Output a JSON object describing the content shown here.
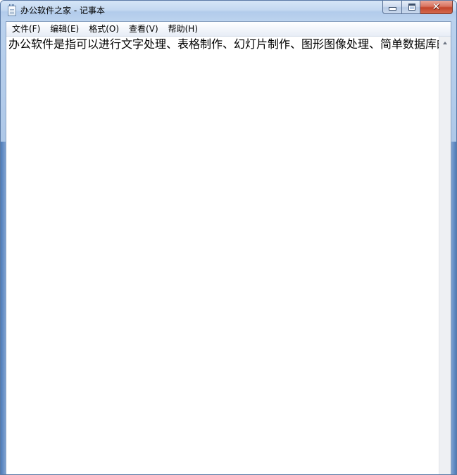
{
  "window": {
    "title": "办公软件之家 - 记事本",
    "app_icon": "notepad-icon"
  },
  "caption_buttons": {
    "minimize_icon": "minimize-icon",
    "maximize_icon": "restore-icon",
    "close_glyph": "✕",
    "close_icon": "close-icon"
  },
  "menu": {
    "items": [
      {
        "label": "文件(F)"
      },
      {
        "label": "编辑(E)"
      },
      {
        "label": "格式(O)"
      },
      {
        "label": "查看(V)"
      },
      {
        "label": "帮助(H)"
      }
    ]
  },
  "editor": {
    "content": "办公软件是指可以进行文字处理、表格制作、幻灯片制作、图形图像处理、简单数据库的"
  },
  "colors": {
    "title_bar": "#c4d9f1",
    "close_button": "#c3452b",
    "frame_border": "#5a7aa6"
  }
}
